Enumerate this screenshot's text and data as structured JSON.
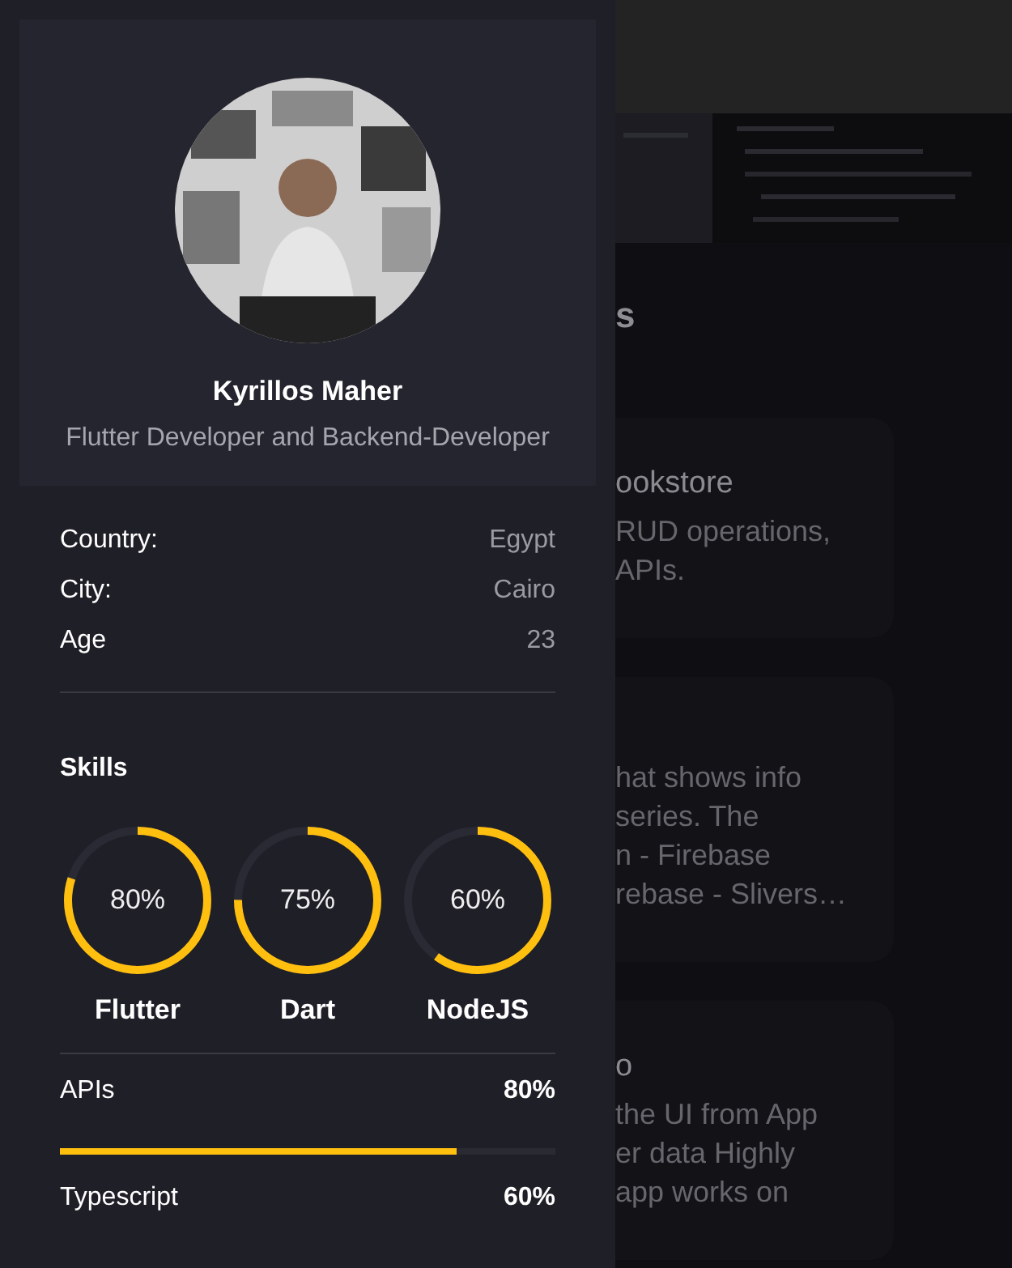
{
  "profile": {
    "name": "Kyrillos Maher",
    "title": "Flutter Developer and Backend-Developer"
  },
  "info": [
    {
      "label": "Country:",
      "value": "Egypt"
    },
    {
      "label": "City:",
      "value": "Cairo"
    },
    {
      "label": "Age",
      "value": "23"
    }
  ],
  "skills": {
    "title": "Skills",
    "rings": [
      {
        "label": "Flutter",
        "reading": "80%"
      },
      {
        "label": "Dart",
        "reading": "75%"
      },
      {
        "label": "NodeJS",
        "reading": "60%"
      }
    ],
    "bars": [
      {
        "label": "APIs",
        "reading": "80%",
        "level": 0.8
      },
      {
        "label": "Typescript",
        "reading": "60%"
      }
    ]
  },
  "background": {
    "heading": "s",
    "cards": [
      {
        "title": "ookstore",
        "lines": [
          "RUD operations,",
          "APIs."
        ]
      },
      {
        "lines": [
          "hat shows info",
          "series. The",
          "n - Firebase",
          "rebase - Slivers…"
        ]
      },
      {
        "title": "o",
        "lines": [
          "the UI from App",
          "er data Highly",
          "app works on"
        ]
      }
    ]
  }
}
